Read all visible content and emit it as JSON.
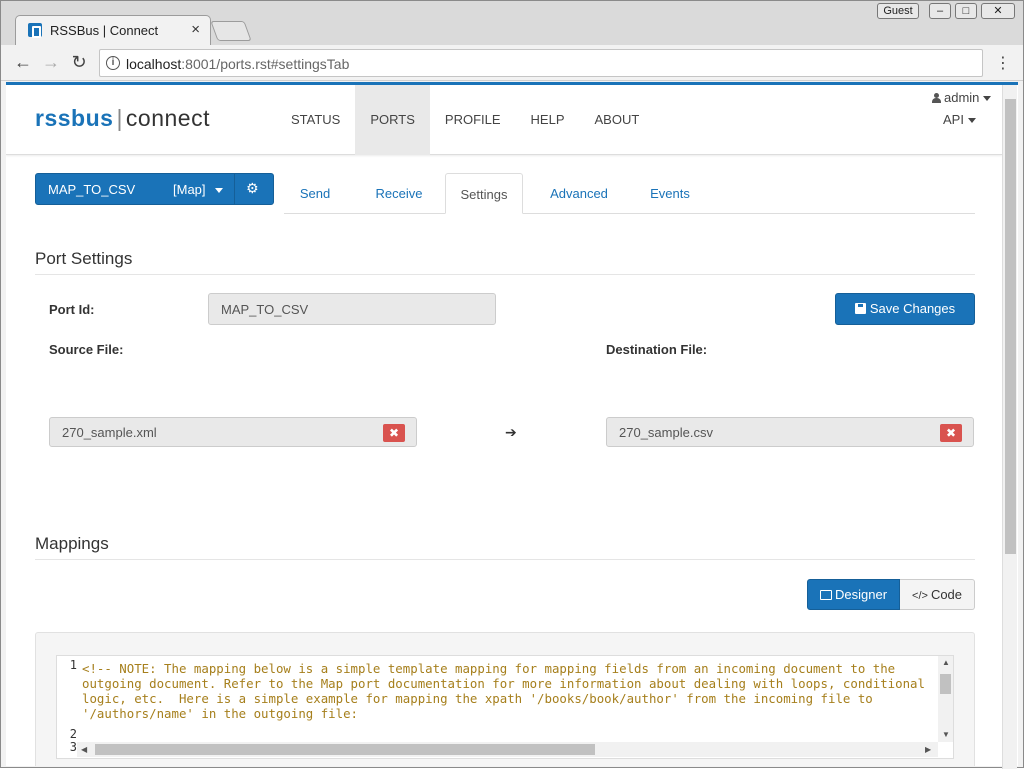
{
  "browser": {
    "tab_title": "RSSBus | Connect",
    "tab_close": "×",
    "guest_label": "Guest",
    "win_min": "‒",
    "win_max": "□",
    "win_close": "✕",
    "url_host": "localhost",
    "url_path": ":8001/ports.rst#settingsTab",
    "back": "←",
    "forward": "→",
    "reload": "↻",
    "menu": "⋮"
  },
  "header": {
    "logo_rss": "rssbus",
    "logo_sep": "|",
    "logo_connect": "connect",
    "nav": [
      "STATUS",
      "PORTS",
      "PROFILE",
      "HELP",
      "ABOUT"
    ],
    "active_nav": "PORTS",
    "user": "admin",
    "api": "API"
  },
  "port": {
    "name": "MAP_TO_CSV",
    "type": "[Map]",
    "gear": "⚙"
  },
  "subtabs": [
    "Send",
    "Receive",
    "Settings",
    "Advanced",
    "Events"
  ],
  "settings": {
    "section_title": "Port Settings",
    "port_id_label": "Port Id:",
    "port_id_value": "MAP_TO_CSV",
    "save_label": "Save Changes",
    "source_label": "Source File:",
    "source_value": "270_sample.xml",
    "dest_label": "Destination File:",
    "dest_value": "270_sample.csv",
    "remove": "✖",
    "arrow": "➔"
  },
  "mappings": {
    "section_title": "Mappings",
    "designer_label": "Designer",
    "code_label": "Code",
    "code_icon": "</>",
    "line_numbers": [
      "1",
      "2",
      "3"
    ],
    "code_text": "<!-- NOTE: The mapping below is a simple template mapping for mapping fields from an incoming document to the\noutgoing document. Refer to the Map port documentation for more information about dealing with loops, conditional\nlogic, etc.  Here is a simple example for mapping the xpath '/books/book/author' from the incoming file to\n'/authors/name' in the outgoing file:"
  },
  "colors": {
    "accent": "#1a73b8",
    "danger": "#d9534f",
    "code_comment": "#a67f1c"
  }
}
